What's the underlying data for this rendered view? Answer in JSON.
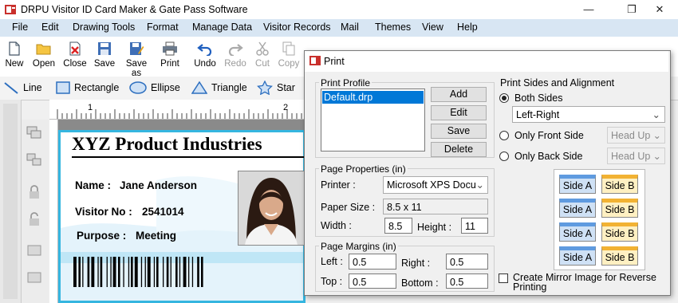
{
  "window": {
    "title": "DRPU Visitor ID Card Maker & Gate Pass Software"
  },
  "menu": [
    "File",
    "Edit",
    "Drawing Tools",
    "Format",
    "Manage Data",
    "Visitor Records",
    "Mail",
    "Themes",
    "View",
    "Help"
  ],
  "toolbar": {
    "new": "New",
    "open": "Open",
    "close": "Close",
    "save": "Save",
    "save_as": "Save as",
    "print": "Print",
    "undo": "Undo",
    "redo": "Redo",
    "cut": "Cut",
    "copy": "Copy"
  },
  "shapes": {
    "line": "Line",
    "rectangle": "Rectangle",
    "ellipse": "Ellipse",
    "triangle": "Triangle",
    "star": "Star"
  },
  "ruler": {
    "label_1": "1",
    "label_2": "2"
  },
  "card": {
    "company": "XYZ Product Industries",
    "name_label": "Name :",
    "name_value": "Jane Anderson",
    "visitor_label": "Visitor No :",
    "visitor_value": "2541014",
    "purpose_label": "Purpose :",
    "purpose_value": "Meeting"
  },
  "dialog": {
    "title": "Print",
    "print_profile": {
      "label": "Print Profile",
      "items": [
        "Default.drp"
      ],
      "add": "Add",
      "edit": "Edit",
      "save": "Save",
      "delete": "Delete"
    },
    "page_properties": {
      "label": "Page Properties (in)",
      "printer_label": "Printer :",
      "printer_value": "Microsoft XPS Docu",
      "paper_size_label": "Paper Size :",
      "paper_size_value": "8.5 x 11",
      "width_label": "Width :",
      "width_value": "8.5",
      "height_label": "Height :",
      "height_value": "11"
    },
    "page_margins": {
      "label": "Page Margins (in)",
      "left_label": "Left :",
      "left_value": "0.5",
      "right_label": "Right :",
      "right_value": "0.5",
      "top_label": "Top :",
      "top_value": "0.5",
      "bottom_label": "Bottom :",
      "bottom_value": "0.5"
    },
    "sides": {
      "label": "Print Sides and Alignment",
      "both_sides": "Both Sides",
      "alignment_value": "Left-Right",
      "front_side": "Only Front Side",
      "back_side": "Only Back Side",
      "front_head": "Head Up",
      "back_head": "Head Up",
      "side_a": "Side A",
      "side_b": "Side B",
      "mirror_label": "Create Mirror Image for Reverse Printing"
    }
  }
}
